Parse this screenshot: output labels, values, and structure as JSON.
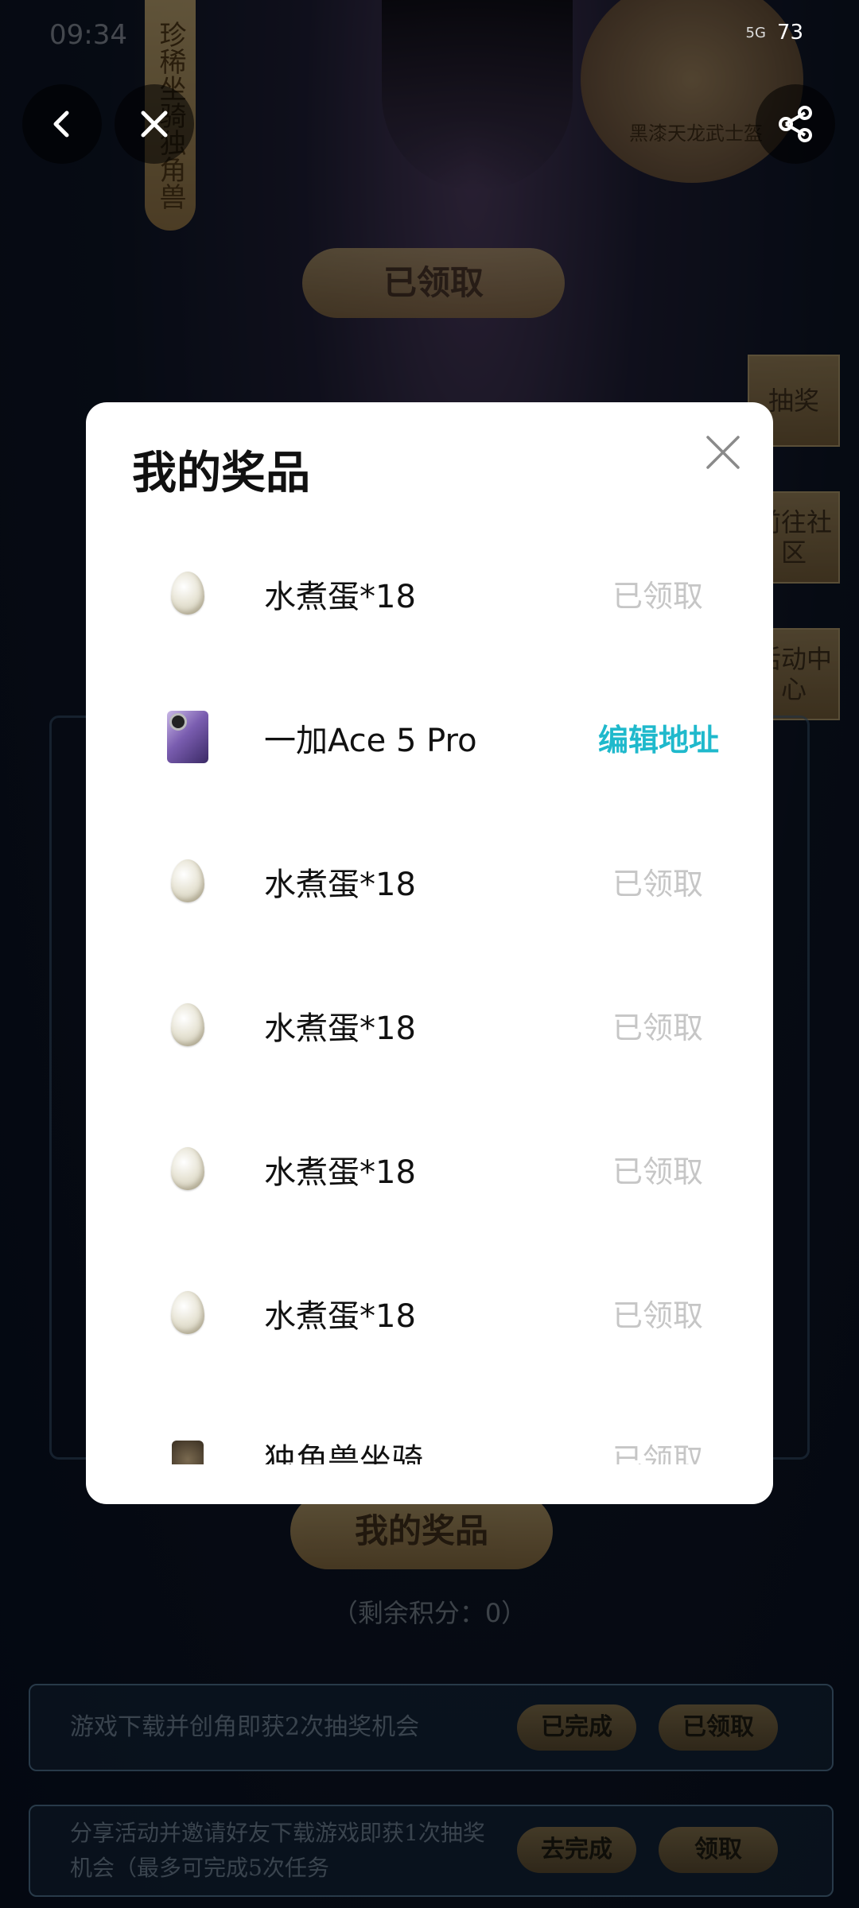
{
  "status_bar": {
    "time": "09:34",
    "network": "5G",
    "battery": "73"
  },
  "background": {
    "vertical_label": "珍稀坐骑独角兽",
    "medal_label": "黑漆天龙武士盔",
    "claimed_top": "已领取",
    "side_tabs": [
      "抽奖",
      "前往社区",
      "活动中心"
    ],
    "my_prizes_button": "我的奖品",
    "points_text": "（剩余积分：0）",
    "tasks": [
      {
        "text": "游戏下载并创角即获2次抽奖机会",
        "btn1": "已完成",
        "btn2": "已领取"
      },
      {
        "text": "分享活动并邀请好友下载游戏即获1次抽奖机会（最多可完成5次任务",
        "btn1": "去完成",
        "btn2": "领取"
      }
    ]
  },
  "modal": {
    "title": "我的奖品",
    "prizes": [
      {
        "name": "水煮蛋*18",
        "status": "已领取",
        "icon": "egg-icon",
        "actionable": false
      },
      {
        "name": "一加Ace 5 Pro",
        "status": "编辑地址",
        "icon": "phone-icon",
        "actionable": true
      },
      {
        "name": "水煮蛋*18",
        "status": "已领取",
        "icon": "egg-icon",
        "actionable": false
      },
      {
        "name": "水煮蛋*18",
        "status": "已领取",
        "icon": "egg-icon",
        "actionable": false
      },
      {
        "name": "水煮蛋*18",
        "status": "已领取",
        "icon": "egg-icon",
        "actionable": false
      },
      {
        "name": "水煮蛋*18",
        "status": "已领取",
        "icon": "egg-icon",
        "actionable": false
      },
      {
        "name": "独角兽坐骑",
        "status": "已领取",
        "icon": "mount-icon",
        "actionable": false
      }
    ]
  },
  "colors": {
    "action": "#1fb9cc",
    "muted": "#c6c6c6",
    "gold": "#c8ab72"
  }
}
